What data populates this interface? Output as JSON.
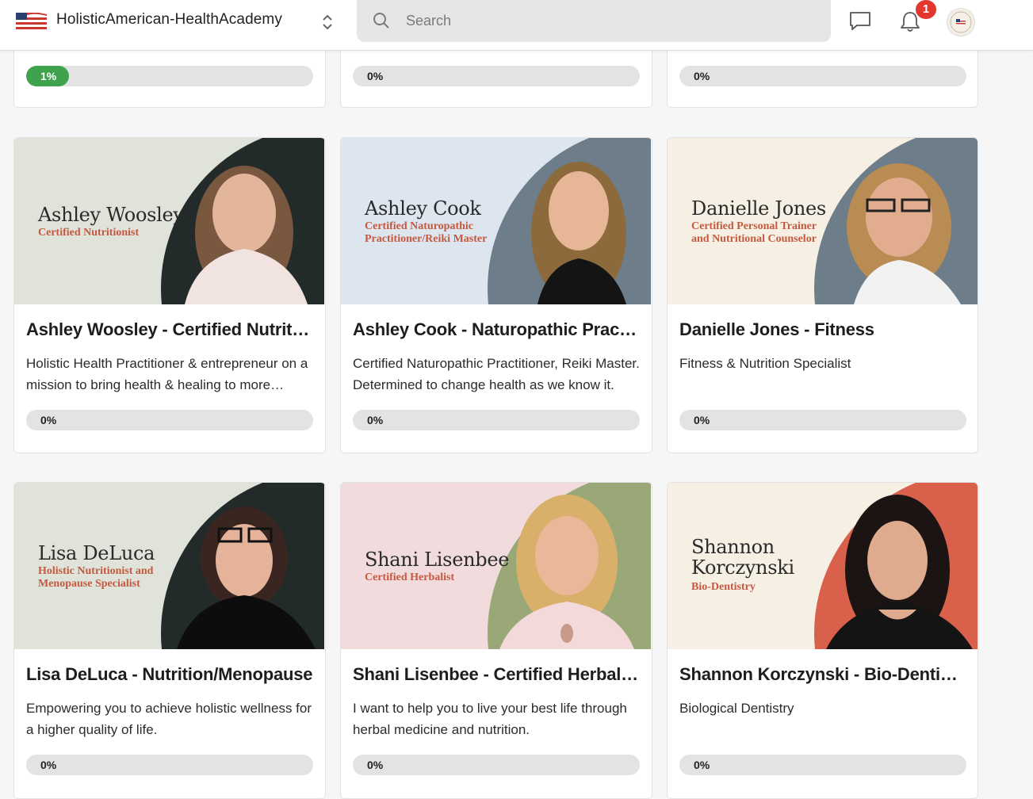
{
  "header": {
    "brand": "HolisticAmerican-HealthAcademy",
    "search_placeholder": "Search",
    "notification_count": "1"
  },
  "colors": {
    "progress_fill": "#3fa34d",
    "progress_track": "#e3e3e3",
    "badge": "#e2362f",
    "banner_role": "#c5593f"
  },
  "top_row": [
    {
      "progress": "1%",
      "progress_value": 1
    },
    {
      "progress": "0%",
      "progress_value": 0
    },
    {
      "progress": "0%",
      "progress_value": 0
    }
  ],
  "cards": [
    {
      "banner_name": "Ashley Woosley",
      "banner_role": "Certified Nutritionist",
      "title": "Ashley Woosley - Certified Nutritionist",
      "description": "Holistic Health Practitioner & entrepreneur on a mission to bring health & healing to more people.",
      "progress": "0%",
      "progress_value": 0
    },
    {
      "banner_name": "Ashley Cook",
      "banner_role": "Certified Naturopathic Practitioner/Reiki Master",
      "title": "Ashley Cook - Naturopathic Practitioner",
      "description": "Certified Naturopathic Practitioner, Reiki Master. Determined to change health as we know it.",
      "progress": "0%",
      "progress_value": 0
    },
    {
      "banner_name": "Danielle Jones",
      "banner_role": "Certified Personal Trainer and Nutritional Counselor",
      "title": "Danielle Jones - Fitness",
      "description": "Fitness & Nutrition Specialist",
      "progress": "0%",
      "progress_value": 0
    },
    {
      "banner_name": "Lisa DeLuca",
      "banner_role": "Holistic Nutritionist and Menopause Specialist",
      "title": "Lisa DeLuca - Nutrition/Menopause",
      "description": "Empowering you to achieve holistic wellness for a higher quality of life.",
      "progress": "0%",
      "progress_value": 0
    },
    {
      "banner_name": "Shani Lisenbee",
      "banner_role": "Certified Herbalist",
      "title": "Shani Lisenbee - Certified Herbalist",
      "description": "I want to help you to live your best life through herbal medicine and nutrition.",
      "progress": "0%",
      "progress_value": 0
    },
    {
      "banner_name": "Shannon Korczynski",
      "banner_role": "Bio-Dentistry",
      "title": "Shannon Korczynski - Bio-Dentistry",
      "description": "Biological Dentistry",
      "progress": "0%",
      "progress_value": 0
    }
  ]
}
